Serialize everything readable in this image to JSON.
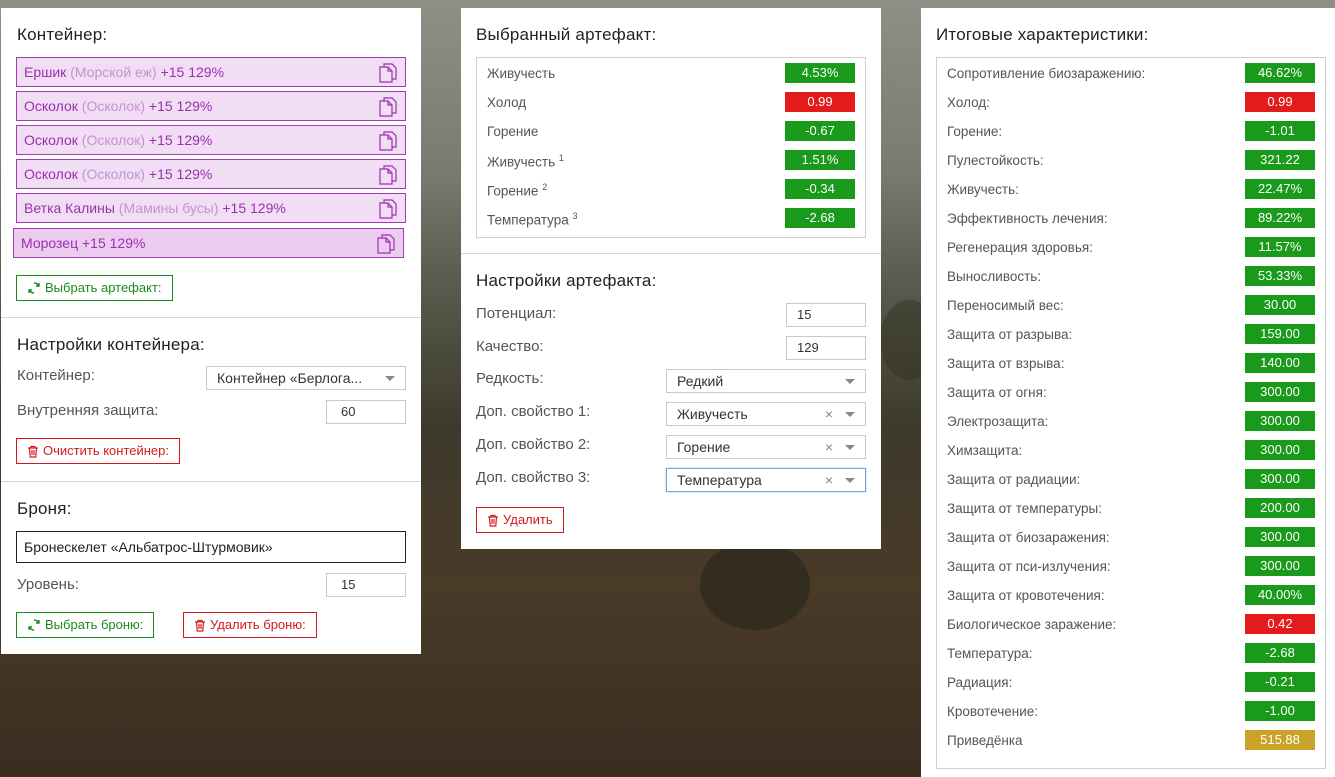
{
  "container_panel": {
    "title": "Контейнер:",
    "items": [
      {
        "name": "Ершик",
        "sub": "(Морской еж)",
        "level": "+15 129%"
      },
      {
        "name": "Осколок",
        "sub": "(Осколок)",
        "level": "+15 129%"
      },
      {
        "name": "Осколок",
        "sub": "(Осколок)",
        "level": "+15 129%"
      },
      {
        "name": "Осколок",
        "sub": "(Осколок)",
        "level": "+15 129%"
      },
      {
        "name": "Ветка Калины",
        "sub": "(Мамины бусы)",
        "level": "+15 129%"
      },
      {
        "name": "Морозец",
        "sub": "",
        "level": "+15 129%"
      }
    ],
    "select_artifact_label": "Выбрать артефакт:",
    "settings_title": "Настройки контейнера:",
    "container_label": "Контейнер:",
    "container_value": "Контейнер «Берлога...",
    "inner_protection_label": "Внутренняя защита:",
    "inner_protection_value": "60",
    "clear_label": "Очистить контейнер:",
    "armor_title": "Броня:",
    "armor_value": "Бронескелет «Альбатрос-Штурмовик»",
    "level_label": "Уровень:",
    "level_value": "15",
    "select_armor_label": "Выбрать броню:",
    "delete_armor_label": "Удалить броню:"
  },
  "artifact_panel": {
    "title": "Выбранный артефакт:",
    "stats": [
      {
        "name": "Живучесть",
        "sup": "",
        "value": "4.53%",
        "color": "green"
      },
      {
        "name": "Холод",
        "sup": "",
        "value": "0.99",
        "color": "red"
      },
      {
        "name": "Горение",
        "sup": "",
        "value": "-0.67",
        "color": "green"
      },
      {
        "name": "Живучесть",
        "sup": "1",
        "value": "1.51%",
        "color": "green"
      },
      {
        "name": "Горение",
        "sup": "2",
        "value": "-0.34",
        "color": "green"
      },
      {
        "name": "Температура",
        "sup": "3",
        "value": "-2.68",
        "color": "green"
      }
    ],
    "settings_title": "Настройки артефакта:",
    "potential_label": "Потенциал:",
    "potential_value": "15",
    "quality_label": "Качество:",
    "quality_value": "129",
    "rarity_label": "Редкость:",
    "rarity_value": "Редкий",
    "prop1_label": "Доп. свойство 1:",
    "prop1_value": "Живучесть",
    "prop2_label": "Доп. свойство 2:",
    "prop2_value": "Горение",
    "prop3_label": "Доп. свойство 3:",
    "prop3_value": "Температура",
    "clear_symbol": "×",
    "delete_label": "Удалить"
  },
  "totals_panel": {
    "title": "Итоговые характеристики:",
    "stats": [
      {
        "name": "Сопротивление биозаражению:",
        "value": "46.62%",
        "color": "green"
      },
      {
        "name": "Холод:",
        "value": "0.99",
        "color": "red"
      },
      {
        "name": "Горение:",
        "value": "-1.01",
        "color": "green"
      },
      {
        "name": "Пулестойкость:",
        "value": "321.22",
        "color": "green"
      },
      {
        "name": "Живучесть:",
        "value": "22.47%",
        "color": "green"
      },
      {
        "name": "Эффективность лечения:",
        "value": "89.22%",
        "color": "green"
      },
      {
        "name": "Регенерация здоровья:",
        "value": "11.57%",
        "color": "green"
      },
      {
        "name": "Выносливость:",
        "value": "53.33%",
        "color": "green"
      },
      {
        "name": "Переносимый вес:",
        "value": "30.00",
        "color": "green"
      },
      {
        "name": "Защита от разрыва:",
        "value": "159.00",
        "color": "green"
      },
      {
        "name": "Защита от взрыва:",
        "value": "140.00",
        "color": "green"
      },
      {
        "name": "Защита от огня:",
        "value": "300.00",
        "color": "green"
      },
      {
        "name": "Электрозащита:",
        "value": "300.00",
        "color": "green"
      },
      {
        "name": "Химзащита:",
        "value": "300.00",
        "color": "green"
      },
      {
        "name": "Защита от радиации:",
        "value": "300.00",
        "color": "green"
      },
      {
        "name": "Защита от температуры:",
        "value": "200.00",
        "color": "green"
      },
      {
        "name": "Защита от биозаражения:",
        "value": "300.00",
        "color": "green"
      },
      {
        "name": "Защита от пси-излучения:",
        "value": "300.00",
        "color": "green"
      },
      {
        "name": "Защита от кровотечения:",
        "value": "40.00%",
        "color": "green"
      },
      {
        "name": "Биологическое заражение:",
        "value": "0.42",
        "color": "red"
      },
      {
        "name": "Температура:",
        "value": "-2.68",
        "color": "green"
      },
      {
        "name": "Радиация:",
        "value": "-0.21",
        "color": "green"
      },
      {
        "name": "Кровотечение:",
        "value": "-1.00",
        "color": "green"
      },
      {
        "name": "Приведёнка",
        "value": "515.88",
        "color": "gold"
      }
    ]
  },
  "colors": {
    "green": "#1a9a1a",
    "red": "#e31b1b",
    "gold": "#c9a227",
    "artifact_border": "#a23db1"
  }
}
